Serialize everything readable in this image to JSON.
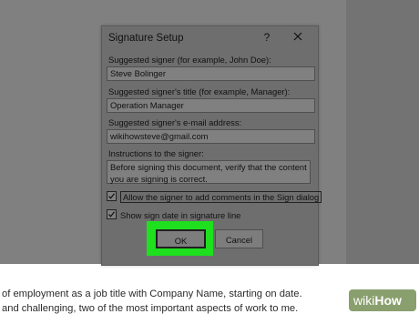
{
  "dialog": {
    "title": "Signature Setup",
    "help_label": "?",
    "fields": [
      {
        "label": "Suggested signer (for example, John Doe):",
        "value": "Steve Bolinger"
      },
      {
        "label": "Suggested signer's title (for example, Manager):",
        "value": "Operation Manager"
      },
      {
        "label": "Suggested signer's e-mail address:",
        "value": "wikihowsteve@gmail.com"
      }
    ],
    "instructions": {
      "label": "Instructions to the signer:",
      "value": "Before signing this document, verify that the content you are signing is correct."
    },
    "checkboxes": [
      {
        "label": "Allow the signer to add comments in the Sign dialog",
        "checked": true
      },
      {
        "label": "Show sign date in signature line",
        "checked": true
      }
    ],
    "buttons": {
      "ok": "OK",
      "cancel": "Cancel"
    },
    "highlight_color": "#1ee01e"
  },
  "document": {
    "lines": [
      "of employment as a job title with Company Name, starting on date.",
      "and challenging, two of the most important aspects of work to me."
    ]
  },
  "watermark": {
    "wiki": "wiki",
    "how": "How"
  }
}
